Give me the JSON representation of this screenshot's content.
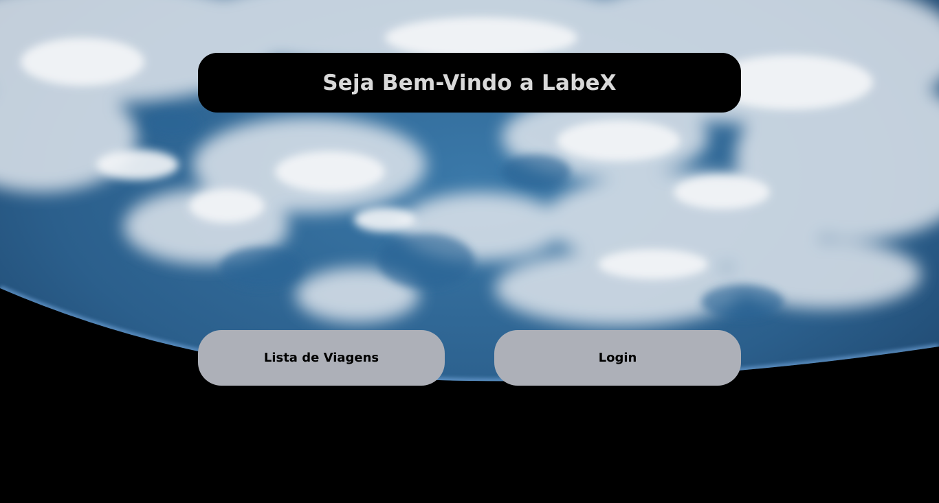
{
  "header": {
    "title": "Seja Bem-Vindo a LabeX"
  },
  "nav": {
    "trips_label": "Lista de Viagens",
    "login_label": "Login"
  },
  "background": {
    "image": "earth-from-space-clouds",
    "ocean_color": "#2f6a9a",
    "space_color": "#000000",
    "cloud_color": "#e8ecf0"
  },
  "colors": {
    "button_bg": "#adb0b8",
    "title_bg": "#000000",
    "title_text": "#d9d9d9"
  }
}
